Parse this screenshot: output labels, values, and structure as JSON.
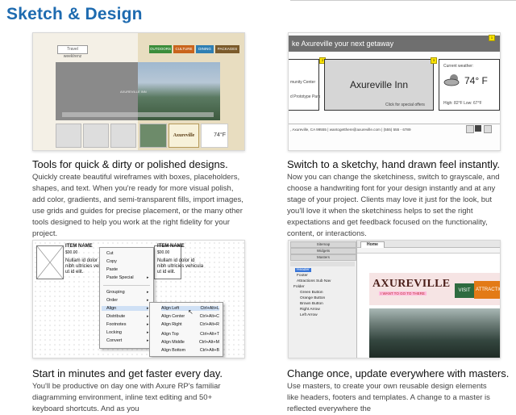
{
  "page": {
    "heading": "Sketch & Design"
  },
  "features": [
    {
      "title": "Tools for quick & dirty or polished designs.",
      "description": "Quickly create beautiful wireframes with boxes, placeholders, shapes, and text. When you're ready for more visual polish, add color, gradients, and semi-transparent fills, import images, use grids and guides for precise placement, or the many other tools designed to help you work at the right fidelity for your project."
    },
    {
      "title": "Switch to a sketchy, hand drawn feel instantly.",
      "description": "Now you can change the sketchiness, switch to grayscale, and choose a handwriting font for your design instantly and at any stage of your project. Clients may love it just for the look, but you'll love it when the sketchiness helps to set the right expectations and get feedback focused on the functionality, content, or interactions."
    },
    {
      "title": "Start in minutes and get faster every day.",
      "description": "You'll be productive on day one with Axure RP's familiar diagramming environment, inline text editing and 50+ keyboard shortcuts. And as you"
    },
    {
      "title": "Change once, update everywhere with masters.",
      "description": "Use masters, to create your own reusable design elements like headers, footers and templates. A change to a master is reflected everywhere the"
    }
  ],
  "shot1": {
    "logo_text": "Travel weeklrenz",
    "nav": [
      "OUTDOORS",
      "CULTURE",
      "DINING",
      "PACKAGES"
    ],
    "nav_colors": [
      "#3b8d3b",
      "#c9641c",
      "#2f7fb3",
      "#7b5b2b"
    ],
    "title_text": "Axureville Inn",
    "weather_temp": "74°F",
    "hero_caption": "AXUREVILLE INN"
  },
  "shot2": {
    "banner": "ke Axureville your next getaway",
    "left_lines": [
      "munity Center",
      "d Prototype Park"
    ],
    "inn_title": "Axureville Inn",
    "inn_sub": "Click for special offers",
    "weather_label": "Current weather:",
    "weather_temp": "74° F",
    "weather_range": "High: 82°F Low: 67°F",
    "footer": ", Axureville, CA 99555 | wantogetthere@axureville.com | (555) 555 - 6789"
  },
  "shot3": {
    "item_name": "ITEM NAME",
    "price": "$00.00",
    "body_lines": [
      "Nullam id dolor id",
      "nibh ultricies vehicula",
      "ut id elit."
    ],
    "menu": [
      "Cut",
      "Copy",
      "Paste",
      "Paste Special",
      "Grouping",
      "Order",
      "Align",
      "Distribute",
      "Footnotes",
      "Locking",
      "Convert"
    ],
    "submenu": [
      {
        "label": "Align Left",
        "key": "Ctrl+Alt+L"
      },
      {
        "label": "Align Center",
        "key": "Ctrl+Alt+C"
      },
      {
        "label": "Align Right",
        "key": "Ctrl+Alt+R"
      },
      {
        "label": "Align Top",
        "key": "Ctrl+Alt+T"
      },
      {
        "label": "Align Middle",
        "key": "Ctrl+Alt+M"
      },
      {
        "label": "Align Bottom",
        "key": "Ctrl+Alt+B"
      }
    ]
  },
  "shot4": {
    "panels": [
      "Sitemap",
      "Widgets",
      "Masters"
    ],
    "tree": [
      "Header",
      "Footer",
      "Attractions Sub Nav",
      "Folder",
      "Green Button",
      "Orange Button",
      "Brown Button",
      "Right Arrow",
      "Left Arrow"
    ],
    "tab": "Home",
    "logo": "AXUREVILLE",
    "tagline": "I WANT TO GO TO THERE",
    "visit": "VISIT",
    "attractions": "ATTRACTIO"
  }
}
